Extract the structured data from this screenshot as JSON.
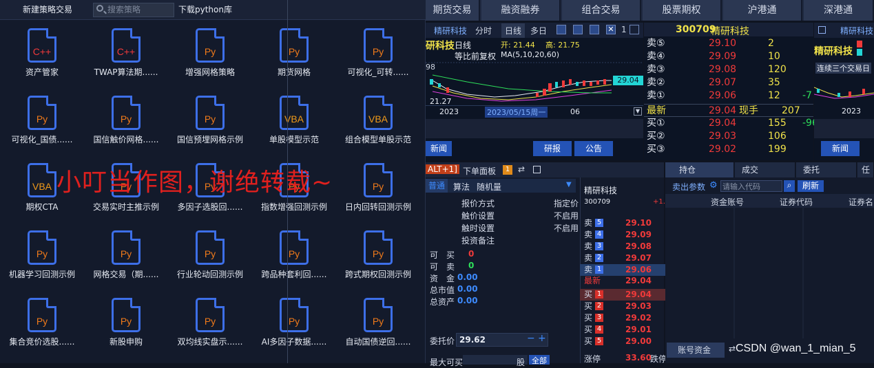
{
  "left_panel": {
    "header": {
      "new_strategy": "新建策略交易",
      "search_placeholder": "搜索策略",
      "download": "下载python库"
    },
    "tiles": [
      {
        "type": "C++",
        "label": "资产管家"
      },
      {
        "type": "C++",
        "label": "TWAP算法期......"
      },
      {
        "type": "Py",
        "label": "增强网格策略"
      },
      {
        "type": "Py",
        "label": "期货网格"
      },
      {
        "type": "Py",
        "label": "可视化_可转......"
      },
      {
        "type": "Py",
        "label": "可视化_国债......"
      },
      {
        "type": "Py",
        "label": "国信触价网格......"
      },
      {
        "type": "Py",
        "label": "国信预埋网格示例"
      },
      {
        "type": "VBA",
        "label": "单股模型示范"
      },
      {
        "type": "VBA",
        "label": "组合模型单股示范"
      },
      {
        "type": "VBA",
        "label": "期权CTA"
      },
      {
        "type": "Py",
        "label": "交易实时主推示例"
      },
      {
        "type": "Py",
        "label": "多因子选股回......"
      },
      {
        "type": "Py",
        "label": "指数增强回测示例"
      },
      {
        "type": "Py",
        "label": "日内回转回测示例"
      },
      {
        "type": "Py",
        "label": "机器学习回测示例"
      },
      {
        "type": "Py",
        "label": "网格交易（期......"
      },
      {
        "type": "Py",
        "label": "行业轮动回测示例"
      },
      {
        "type": "Py",
        "label": "跨品种套利回......"
      },
      {
        "type": "Py",
        "label": "跨式期权回测示例"
      },
      {
        "type": "Py",
        "label": "集合竞价选股......"
      },
      {
        "type": "Py",
        "label": "新股申购"
      },
      {
        "type": "Py",
        "label": "双均线实盘示......"
      },
      {
        "type": "Py",
        "label": "AI多因子数据......"
      },
      {
        "type": "Py",
        "label": "自动国债逆回......"
      }
    ],
    "watermark": "小叮当作图，谢绝转载~"
  },
  "top_nav": [
    "期货交易",
    "融资融券",
    "组合交易",
    "股票期权",
    "沪港通",
    "深港通"
  ],
  "chart1": {
    "stock": "精研科技",
    "tabs": [
      "分时",
      "日线",
      "多日"
    ],
    "line_label": "日线",
    "adjust": "等比前复权",
    "ma": "MA(5,10,20,60)",
    "open_label": "开: 21.44",
    "high_label": "高: 21.75",
    "price_tag": "29.04",
    "year": "2023",
    "date_tag": "2023/05/15周一",
    "month": "06",
    "left_price": "98",
    "low_price": "21.27",
    "buttons": [
      "新闻",
      "研报",
      "公告"
    ]
  },
  "order_book": {
    "code": "300709",
    "name": "精研科技",
    "asks": [
      {
        "label": "卖⑤",
        "price": "29.10",
        "vol": "2",
        "chg": ""
      },
      {
        "label": "卖④",
        "price": "29.09",
        "vol": "10",
        "chg": ""
      },
      {
        "label": "卖③",
        "price": "29.08",
        "vol": "120",
        "chg": ""
      },
      {
        "label": "卖②",
        "price": "29.07",
        "vol": "35",
        "chg": ""
      },
      {
        "label": "卖①",
        "price": "29.06",
        "vol": "12",
        "chg": "-7"
      }
    ],
    "last": {
      "label": "最新",
      "price": "29.04",
      "unit": "现手",
      "vol": "207"
    },
    "bids": [
      {
        "label": "买①",
        "price": "29.04",
        "vol": "155",
        "chg": "-96"
      },
      {
        "label": "买②",
        "price": "29.03",
        "vol": "106",
        "chg": ""
      },
      {
        "label": "买③",
        "price": "29.02",
        "vol": "199",
        "chg": ""
      }
    ]
  },
  "chart3": {
    "stock": "精研科技",
    "note": "连续三个交易日",
    "date": "2023",
    "button": "新闻"
  },
  "order_panel": {
    "hotkey": "ALT+1]",
    "title": "下单面板",
    "badge": "1",
    "tabs": [
      "普通",
      "算法",
      "随机量"
    ],
    "stock_name": "精研科技",
    "stock_code": "300709",
    "stock_chg": "+1.",
    "fields": [
      {
        "name": "报价方式",
        "value": "指定价"
      },
      {
        "name": "触价设置",
        "value": "不启用"
      },
      {
        "name": "触时设置",
        "value": "不启用"
      },
      {
        "name": "投资备注",
        "value": ""
      }
    ],
    "stats": [
      {
        "name": "可　买",
        "value": "0",
        "color": "#f03a3a"
      },
      {
        "name": "可　卖",
        "value": "0",
        "color": "#2ee05a"
      },
      {
        "name": "资　金",
        "value": "0.00",
        "color": "#3d8bff"
      },
      {
        "name": "总市值",
        "value": "0.00",
        "color": "#3d8bff"
      },
      {
        "name": "总资产",
        "value": "0.00",
        "color": "#3d8bff"
      }
    ],
    "price_label": "委托价",
    "price_value": "29.62",
    "max_label": "最大可买",
    "max_unit": "股",
    "all_btn": "全部",
    "mini_asks": [
      {
        "label": "卖",
        "n": "5",
        "price": "29.10"
      },
      {
        "label": "卖",
        "n": "4",
        "price": "29.09"
      },
      {
        "label": "卖",
        "n": "3",
        "price": "29.08"
      },
      {
        "label": "卖",
        "n": "2",
        "price": "29.07"
      },
      {
        "label": "卖",
        "n": "1",
        "price": "29.06"
      }
    ],
    "mini_last": {
      "label": "最新",
      "price": "29.04"
    },
    "mini_bids": [
      {
        "label": "买",
        "n": "1",
        "price": "29.04"
      },
      {
        "label": "买",
        "n": "2",
        "price": "29.03"
      },
      {
        "label": "买",
        "n": "3",
        "price": "29.02"
      },
      {
        "label": "买",
        "n": "4",
        "price": "29.01"
      },
      {
        "label": "买",
        "n": "5",
        "price": "29.00"
      }
    ],
    "limit_up_label": "涨停",
    "limit_up": "33.60",
    "limit_down_label": "跌停"
  },
  "positions": {
    "tabs": [
      "持仓",
      "成交",
      "委托",
      "任"
    ],
    "sell_param": "卖出参数",
    "code_placeholder": "请输入代码",
    "refresh": "刷新",
    "columns": [
      "资金账号",
      "证券代码",
      "证券名"
    ],
    "bottom_tab": "账号资金"
  },
  "csdn": "CSDN @wan_1_mian_5"
}
